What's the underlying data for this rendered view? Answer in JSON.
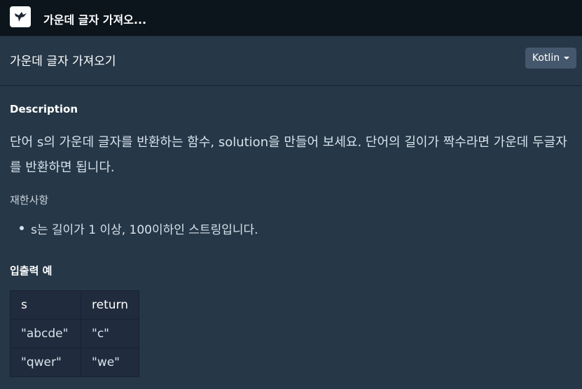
{
  "topbar": {
    "logo_icon": "bird-logo-icon",
    "app_title": "가운데 글자 가져오..."
  },
  "header": {
    "problem_title": "가운데 글자 가져오기",
    "language": "Kotlin"
  },
  "description": {
    "heading": "Description",
    "text": "단어 s의 가운데 글자를 반환하는 함수, solution을 만들어 보세요. 단어의 길이가 짝수라면 가운데 두글자를 반환하면 됩니다.",
    "constraints_title": "재한사항",
    "constraints": [
      "s는 길이가 1 이상, 100이하인 스트링입니다."
    ]
  },
  "examples": {
    "heading": "입출력 예",
    "columns": [
      "s",
      "return"
    ],
    "rows": [
      [
        "\"abcde\"",
        "\"c\""
      ],
      [
        "\"qwer\"",
        "\"we\""
      ]
    ]
  },
  "colors": {
    "topbar_bg": "#0c151c",
    "content_bg": "#263747",
    "table_bg": "#202b3d",
    "lang_button_bg": "#44576c"
  }
}
